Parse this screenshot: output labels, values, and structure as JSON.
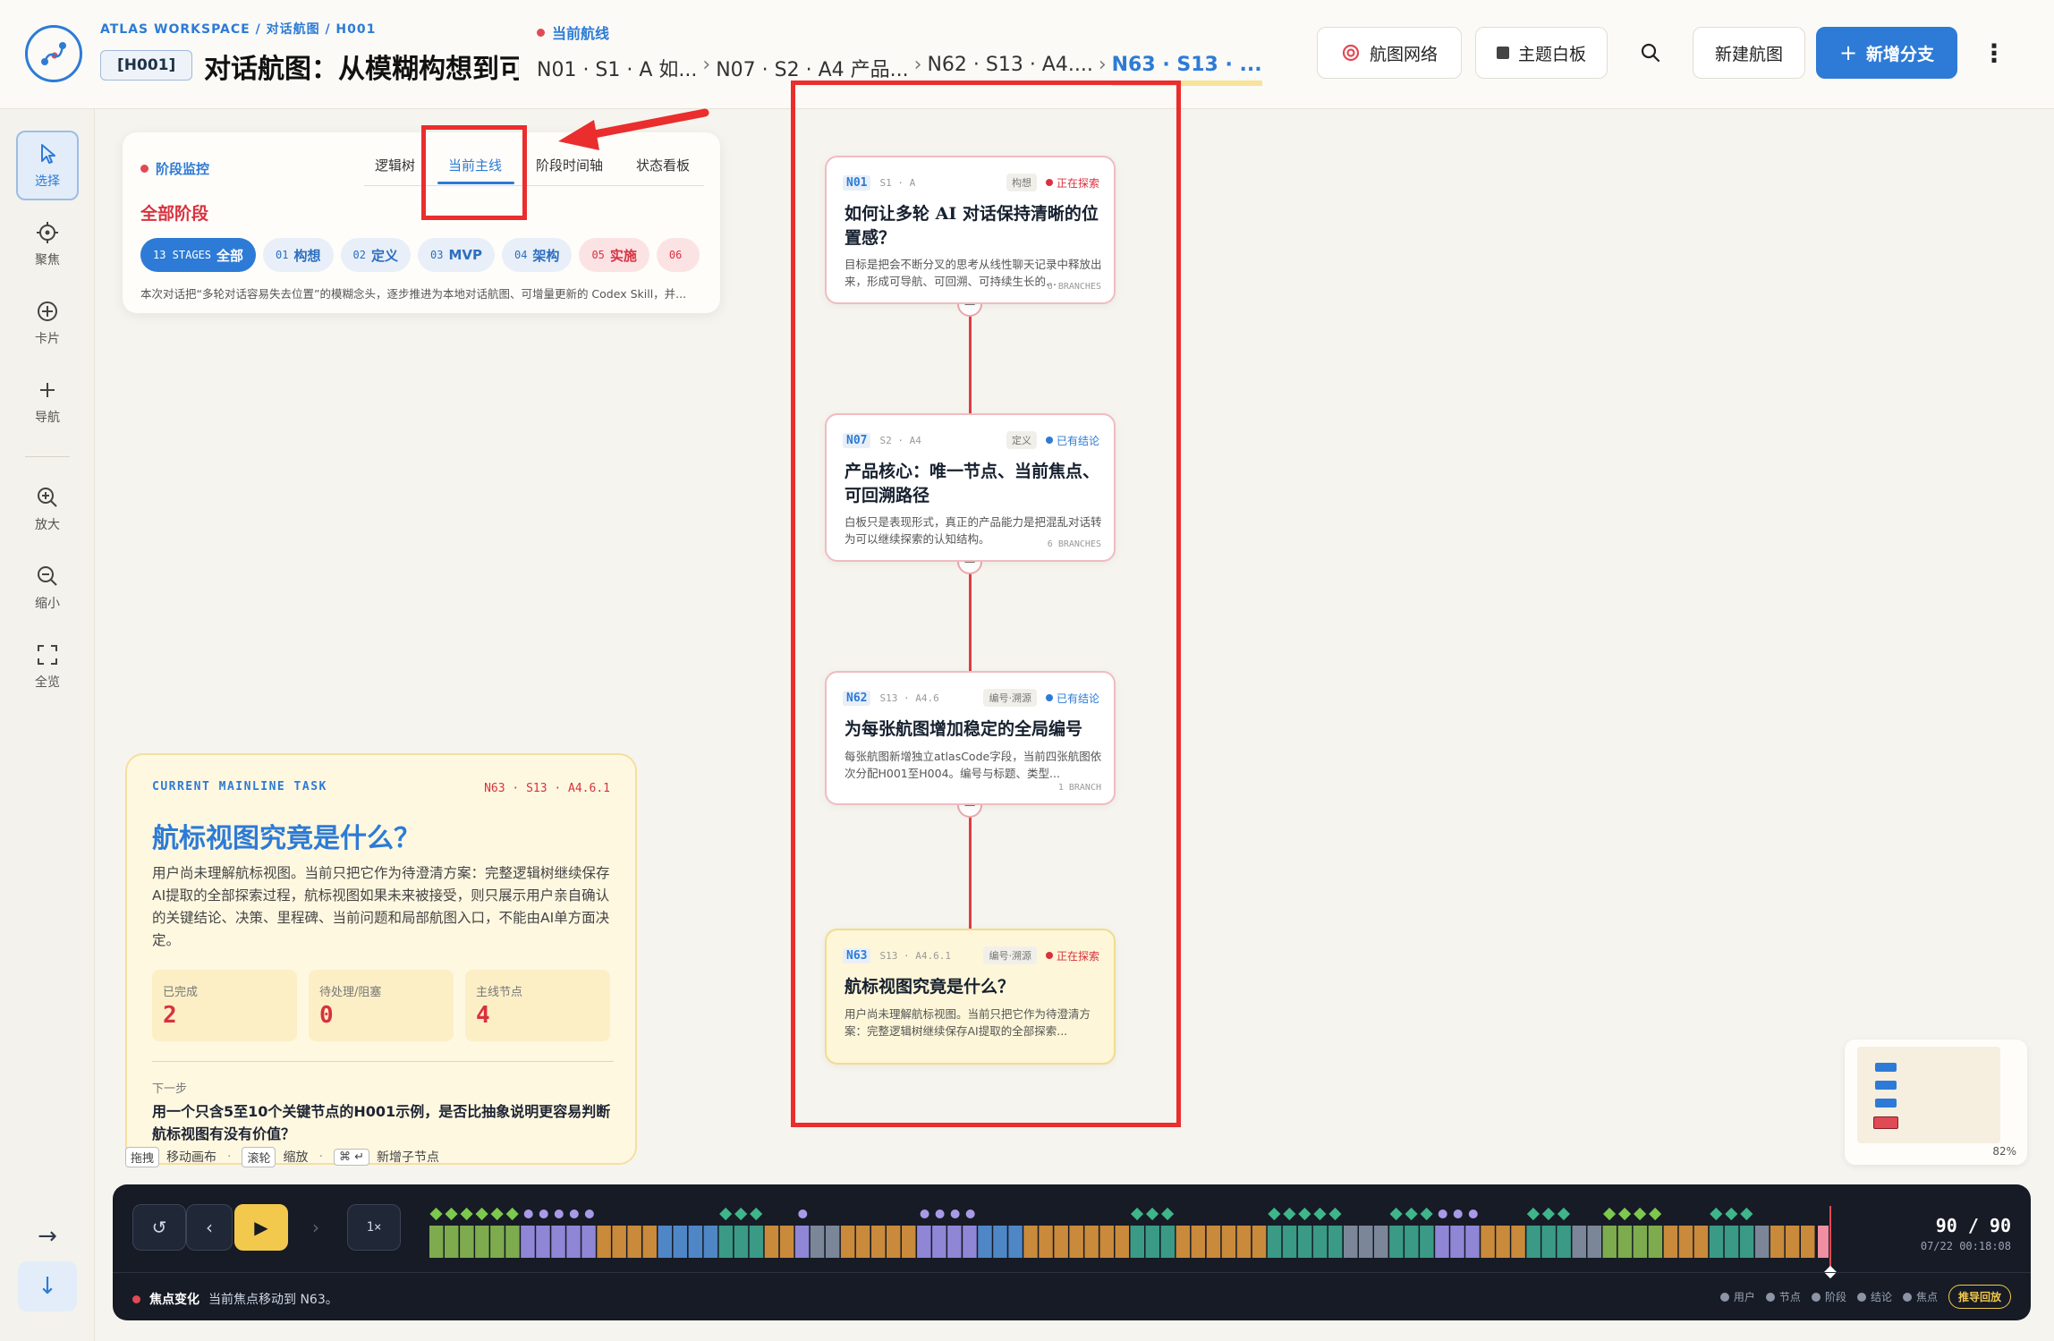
{
  "header": {
    "breadcrumb": "ATLAS WORKSPACE / 对话航图 / H001",
    "map_code": "[H001]",
    "map_title": "对话航图：从模糊构想到可",
    "route_label": "当前航线",
    "route_segments": [
      "N01 · S1 · A 如...",
      "N07 · S2 · A4 产品...",
      "N62 · S13 · A4....",
      "N63 · S13 · ..."
    ],
    "btn_network": "航图网络",
    "btn_whiteboard": "主题白板",
    "btn_newmap": "新建航图",
    "btn_branch": "新增分支"
  },
  "tools": {
    "select": "选择",
    "focus": "聚焦",
    "card": "卡片",
    "nav": "导航",
    "zoom_in": "放大",
    "zoom_out": "缩小",
    "fit": "全览"
  },
  "monitor": {
    "label": "阶段监控",
    "tabs": [
      "逻辑树",
      "当前主线",
      "阶段时间轴",
      "状态看板"
    ],
    "all_stages": "全部阶段",
    "chips": [
      {
        "num": "13 STAGES",
        "label": "全部"
      },
      {
        "num": "01",
        "label": "构想"
      },
      {
        "num": "02",
        "label": "定义"
      },
      {
        "num": "03",
        "label": "MVP"
      },
      {
        "num": "04",
        "label": "架构"
      },
      {
        "num": "05",
        "label": "实施"
      },
      {
        "num": "06",
        "label": ""
      }
    ],
    "desc": "本次对话把“多轮对话容易失去位置”的模糊念头，逐步推进为本地对话航图、可增量更新的 Codex Skill，并..."
  },
  "nodes": [
    {
      "id": "N01",
      "meta": "S1 · A",
      "tag": "构想",
      "status": "正在探索",
      "title": "如何让多轮 AI 对话保持清晰的位置感？",
      "desc": "目标是把会不断分叉的思考从线性聊天记录中释放出来，形成可导航、可回溯、可持续生长的...",
      "branches": "6 BRANCHES"
    },
    {
      "id": "N07",
      "meta": "S2 · A4",
      "tag": "定义",
      "status": "已有结论",
      "title": "产品核心：唯一节点、当前焦点、可回溯路径",
      "desc": "白板只是表现形式，真正的产品能力是把混乱对话转为可以继续探索的认知结构。",
      "branches": "6 BRANCHES"
    },
    {
      "id": "N62",
      "meta": "S13 · A4.6",
      "tag": "编号·溯源",
      "status": "已有结论",
      "title": "为每张航图增加稳定的全局编号",
      "desc": "每张航图新增独立atlasCode字段，当前四张航图依次分配H001至H004。编号与标题、类型...",
      "branches": "1 BRANCH"
    },
    {
      "id": "N63",
      "meta": "S13 · A4.6.1",
      "tag": "编号·溯源",
      "status": "正在探索",
      "title": "航标视图究竟是什么？",
      "desc": "用户尚未理解航标视图。当前只把它作为待澄清方案：完整逻辑树继续保存AI提取的全部探索...",
      "branches": ""
    }
  ],
  "task": {
    "kicker": "CURRENT MAINLINE TASK",
    "ref": "N63 · S13 · A4.6.1",
    "title": "航标视图究竟是什么？",
    "desc": "用户尚未理解航标视图。当前只把它作为待澄清方案：完整逻辑树继续保存AI提取的全部探索过程，航标视图如果未来被接受，则只展示用户亲自确认的关键结论、决策、里程碑、当前问题和局部航图入口，不能由AI单方面决定。",
    "stats": [
      {
        "label": "已完成",
        "value": "2"
      },
      {
        "label": "待处理/阻塞",
        "value": "0"
      },
      {
        "label": "主线节点",
        "value": "4"
      }
    ],
    "next_label": "下一步",
    "next_text": "用一个只含5至10个关键节点的H001示例，是否比抽象说明更容易判断航标视图有没有价值？"
  },
  "hints": {
    "drag_key": "拖拽",
    "drag_text": "移动画布",
    "wheel_key": "滚轮",
    "wheel_text": "缩放",
    "enter_key": "⌘ ↵",
    "enter_text": "新增子节点"
  },
  "minimap": {
    "zoom": "82%"
  },
  "timeline": {
    "speed": "1×",
    "count": "90 / 90",
    "time": "07/22 00:18:08",
    "event_title": "焦点变化",
    "event_text": "当前焦点移动到 N63。",
    "legend": [
      "用户",
      "节点",
      "阶段",
      "结论",
      "焦点"
    ],
    "guide": "推导回放",
    "palette": [
      "#7dab4e",
      "#8f86d6",
      "#c98a3c",
      "#4f86c6",
      "#3a9a86",
      "#7b8698"
    ],
    "segments": [
      0,
      0,
      0,
      0,
      0,
      0,
      1,
      1,
      1,
      1,
      1,
      2,
      2,
      2,
      2,
      3,
      3,
      3,
      3,
      4,
      4,
      4,
      2,
      2,
      1,
      5,
      5,
      2,
      2,
      2,
      2,
      2,
      1,
      1,
      1,
      1,
      3,
      3,
      3,
      2,
      2,
      2,
      2,
      2,
      2,
      2,
      4,
      4,
      4,
      2,
      2,
      2,
      2,
      2,
      2,
      4,
      4,
      4,
      4,
      4,
      5,
      5,
      5,
      4,
      4,
      4,
      1,
      1,
      1,
      2,
      2,
      2,
      4,
      4,
      4,
      5,
      5,
      0,
      0,
      0,
      0,
      2,
      2,
      2,
      4,
      4,
      4,
      5,
      2,
      2,
      2
    ]
  }
}
